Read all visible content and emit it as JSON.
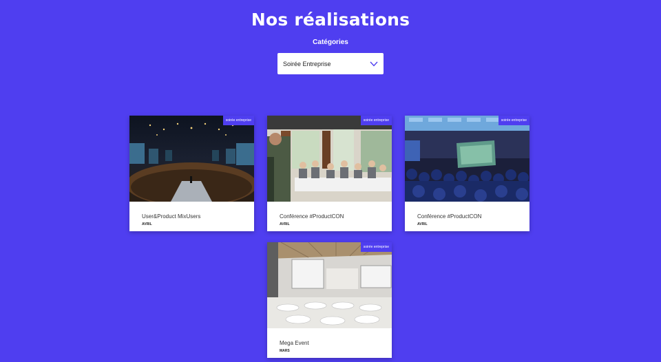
{
  "header": {
    "title": "Nos réalisations"
  },
  "filter": {
    "label": "Catégories",
    "selected": "Soirée Entreprise"
  },
  "icons": {
    "dropdown": "chevron-down-icon"
  },
  "colors": {
    "background": "#4f3ef0",
    "accent": "#4f3ef0",
    "card": "#ffffff"
  },
  "cards": [
    {
      "badge": "soirée entreprise",
      "title": "User&Product MixUsers",
      "month": "AVRIL"
    },
    {
      "badge": "soirée entreprise",
      "title": "Conférence #ProductCON",
      "month": "AVRIL"
    },
    {
      "badge": "soirée entreprise",
      "title": "Conférence #ProductCON",
      "month": "AVRIL"
    },
    {
      "badge": "soirée entreprise",
      "title": "Mega Event",
      "month": "MARS"
    }
  ]
}
